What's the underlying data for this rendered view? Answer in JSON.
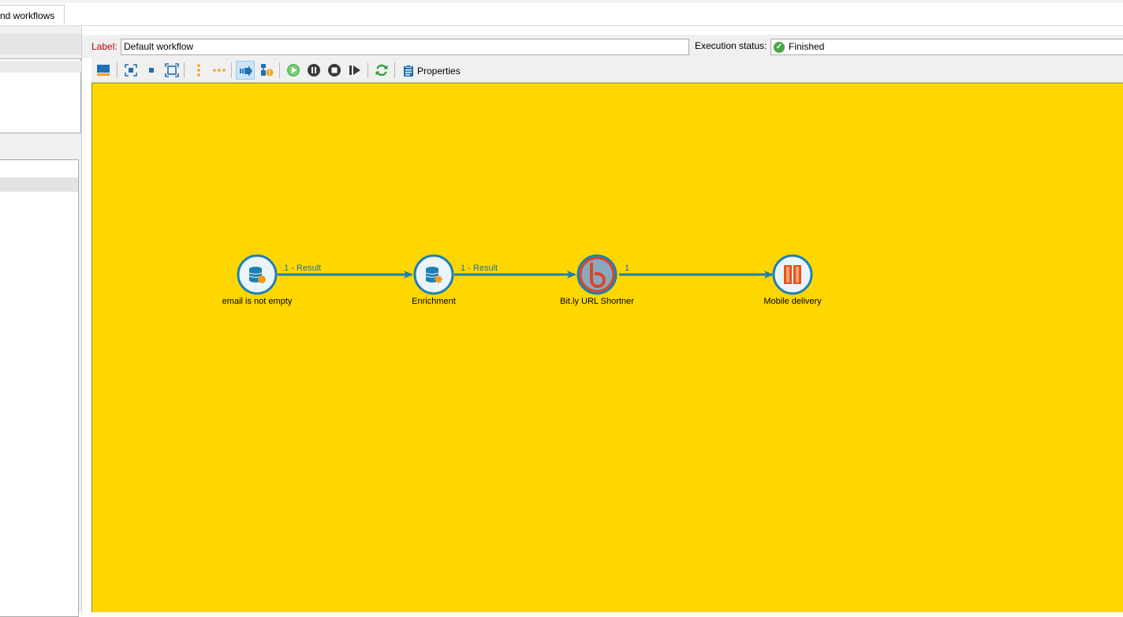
{
  "tab": {
    "label": "nd workflows"
  },
  "form": {
    "label_caption": "Label:",
    "label_value": "Default workflow",
    "exec_caption": "Execution status:",
    "exec_value": "Finished"
  },
  "toolbar": {
    "items": [
      "display-mode-icon",
      "zoom-fit-icon",
      "stop-square-icon",
      "zoom-area-icon",
      "vertical-dots-icon",
      "horizontal-dots-icon",
      "forward-arrow-icon",
      "workflow-alert-icon",
      "start-icon",
      "pause-icon",
      "stop-icon",
      "step-icon",
      "refresh-icon",
      "properties-icon"
    ],
    "properties_label": "Properties"
  },
  "workflow": {
    "nodes": [
      {
        "label": "email is not empty",
        "icon": "query-icon"
      },
      {
        "label": "Enrichment",
        "icon": "enrichment-icon"
      },
      {
        "label": "Bit.ly URL Shortner",
        "icon": "bitly-icon"
      },
      {
        "label": "Mobile delivery",
        "icon": "mobile-delivery-icon"
      }
    ],
    "links": [
      {
        "label": "1 - Result"
      },
      {
        "label": "1 - Result"
      },
      {
        "label": "1"
      }
    ]
  },
  "colors": {
    "canvas": "#ffd700",
    "link": "#1e7fb0",
    "label_red": "#c00000",
    "status_ok": "#46a649"
  }
}
